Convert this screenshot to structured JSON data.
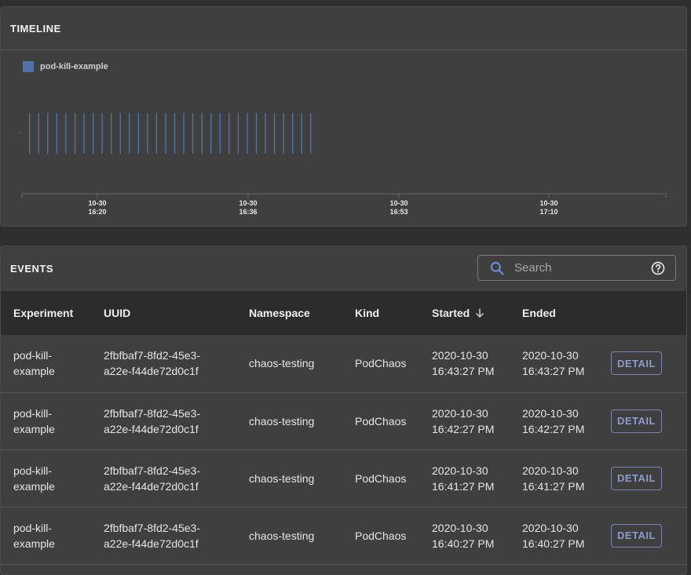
{
  "timeline": {
    "title": "TIMELINE",
    "legend_label": "pod-kill-example",
    "series_color": "#4f73a6",
    "axis_ticks": [
      {
        "date": "10-30",
        "time": "16:20"
      },
      {
        "date": "10-30",
        "time": "16:36"
      },
      {
        "date": "10-30",
        "time": "16:53"
      },
      {
        "date": "10-30",
        "time": "17:10"
      }
    ]
  },
  "events": {
    "title": "EVENTS",
    "search_placeholder": "Search",
    "columns": [
      "Experiment",
      "UUID",
      "Namespace",
      "Kind",
      "Started",
      "Ended"
    ],
    "detail_label": "DETAIL",
    "rows": [
      {
        "experiment": [
          "pod-kill-",
          "example"
        ],
        "uuid": [
          "2fbfbaf7-8fd2-45e3-",
          "a22e-f44de72d0c1f"
        ],
        "namespace": "chaos-testing",
        "kind": "PodChaos",
        "started": [
          "2020-10-30",
          "16:43:27 PM"
        ],
        "ended": [
          "2020-10-30",
          "16:43:27 PM"
        ]
      },
      {
        "experiment": [
          "pod-kill-",
          "example"
        ],
        "uuid": [
          "2fbfbaf7-8fd2-45e3-",
          "a22e-f44de72d0c1f"
        ],
        "namespace": "chaos-testing",
        "kind": "PodChaos",
        "started": [
          "2020-10-30",
          "16:42:27 PM"
        ],
        "ended": [
          "2020-10-30",
          "16:42:27 PM"
        ]
      },
      {
        "experiment": [
          "pod-kill-",
          "example"
        ],
        "uuid": [
          "2fbfbaf7-8fd2-45e3-",
          "a22e-f44de72d0c1f"
        ],
        "namespace": "chaos-testing",
        "kind": "PodChaos",
        "started": [
          "2020-10-30",
          "16:41:27 PM"
        ],
        "ended": [
          "2020-10-30",
          "16:41:27 PM"
        ]
      },
      {
        "experiment": [
          "pod-kill-",
          "example"
        ],
        "uuid": [
          "2fbfbaf7-8fd2-45e3-",
          "a22e-f44de72d0c1f"
        ],
        "namespace": "chaos-testing",
        "kind": "PodChaos",
        "started": [
          "2020-10-30",
          "16:40:27 PM"
        ],
        "ended": [
          "2020-10-30",
          "16:40:27 PM"
        ]
      }
    ]
  }
}
